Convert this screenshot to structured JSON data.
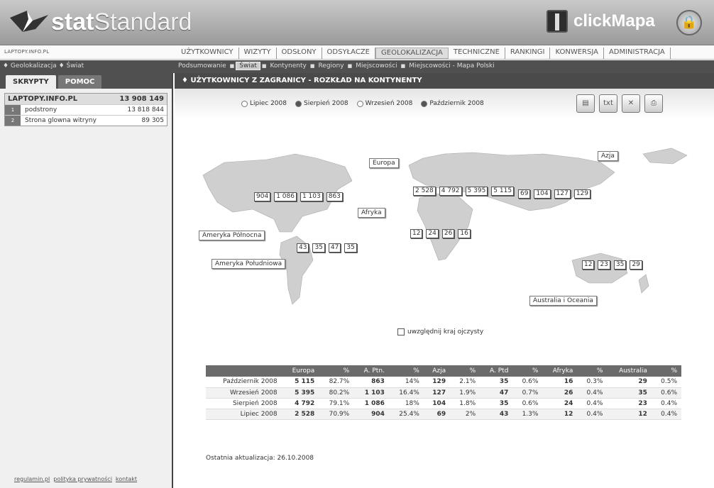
{
  "header": {
    "logo_bold": "stat",
    "logo_light": "Standard",
    "clickmapa": "clickMapa"
  },
  "nav": {
    "site_small": "LAPTOPY.INFO.PL",
    "items": [
      "UŻYTKOWNICY",
      "WIZYTY",
      "ODSŁONY",
      "ODSYŁACZE",
      "GEOLOKALIZACJA",
      "TECHNICZNE",
      "RANKINGI",
      "KONWERSJA",
      "ADMINISTRACJA"
    ],
    "active_index": 4
  },
  "subnav": {
    "crumb": "♦ Geolokalizacja ♦ Świat",
    "items": [
      "Podsumowanie",
      "Świat",
      "Kontynenty",
      "Regiony",
      "Miejscowości",
      "Miejscowości - Mapa Polski"
    ],
    "selected_index": 1
  },
  "left": {
    "tab_scripts": "SKRYPTY",
    "tab_help": "POMOC",
    "site_name": "LAPTOPY.INFO.PL",
    "site_total": "13 908 149",
    "rows": [
      {
        "num": "1",
        "label": "podstrony",
        "value": "13 818 844"
      },
      {
        "num": "2",
        "label": "Strona glowna witryny",
        "value": "89 305"
      }
    ],
    "links": [
      "regulamin.pl",
      "polityka prywatności",
      "kontakt"
    ]
  },
  "content": {
    "title": "♦ UŻYTKOWNICY Z ZAGRANICY - ROZKŁAD NA KONTYNENTY",
    "months": [
      {
        "label": "Lipiec 2008",
        "checked": false
      },
      {
        "label": "Sierpień 2008",
        "checked": true
      },
      {
        "label": "Wrzesień 2008",
        "checked": false
      },
      {
        "label": "Październik 2008",
        "checked": true
      }
    ],
    "export_icons": [
      "doc-icon",
      "txt-icon",
      "excel-icon",
      "print-icon"
    ],
    "txt_label": "txt",
    "home_country": "uwzględnij kraj ojczysty",
    "updated": "Ostatnia aktualizacja: 26.10.2008"
  },
  "map": {
    "labels": {
      "europa": "Europa",
      "azja": "Azja",
      "afryka": "Afryka",
      "ameryka_pn": "Ameryka Północna",
      "ameryka_pd": "Ameryka Południowa",
      "australia": "Australia i Oceania"
    },
    "values": {
      "ameryka_pn": [
        "904",
        "1 086",
        "1 103",
        "863"
      ],
      "europa": [
        "2 528",
        "4 792",
        "5 395",
        "5 115"
      ],
      "azja": [
        "69",
        "104",
        "127",
        "129"
      ],
      "afryka": [
        "12",
        "24",
        "26",
        "16"
      ],
      "ameryka_pd": [
        "43",
        "35",
        "47",
        "35"
      ],
      "australia": [
        "12",
        "23",
        "35",
        "29"
      ]
    }
  },
  "table": {
    "headers": [
      "",
      "Europa",
      "%",
      "A. Ptn.",
      "%",
      "Azja",
      "%",
      "A. Ptd",
      "%",
      "Afryka",
      "%",
      "Australia",
      "%"
    ],
    "rows": [
      [
        "Październik 2008",
        "5 115",
        "82.7%",
        "863",
        "14%",
        "129",
        "2.1%",
        "35",
        "0.6%",
        "16",
        "0.3%",
        "29",
        "0.5%"
      ],
      [
        "Wrzesień 2008",
        "5 395",
        "80.2%",
        "1 103",
        "16.4%",
        "127",
        "1.9%",
        "47",
        "0.7%",
        "26",
        "0.4%",
        "35",
        "0.6%"
      ],
      [
        "Sierpień 2008",
        "4 792",
        "79.1%",
        "1 086",
        "18%",
        "104",
        "1.8%",
        "35",
        "0.6%",
        "24",
        "0.4%",
        "23",
        "0.4%"
      ],
      [
        "Lipiec 2008",
        "2 528",
        "70.9%",
        "904",
        "25.4%",
        "69",
        "2%",
        "43",
        "1.3%",
        "12",
        "0.4%",
        "12",
        "0.4%"
      ]
    ]
  }
}
